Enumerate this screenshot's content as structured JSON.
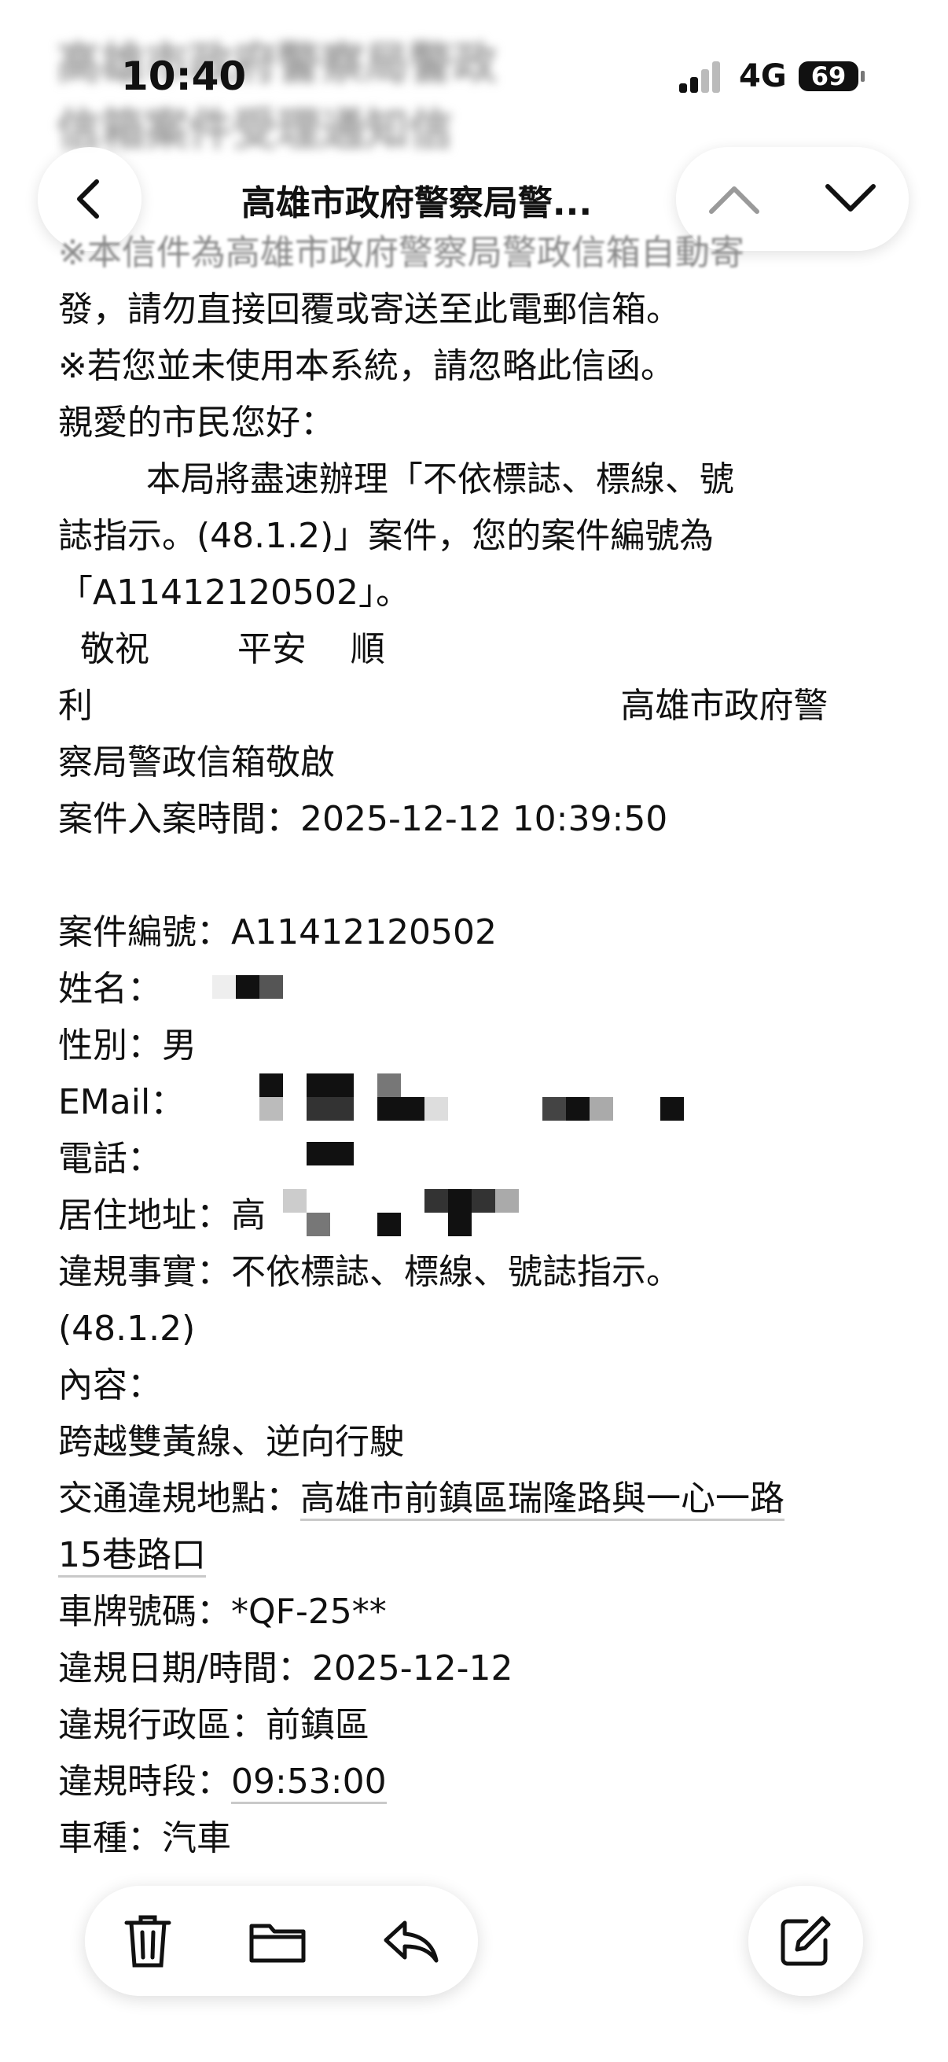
{
  "status_bar": {
    "time": "10:40",
    "network": "4G",
    "battery": "69"
  },
  "header_ghost": [
    "高雄市政府警察局警政",
    "信箱案件受理通知信"
  ],
  "nav": {
    "title": "高雄市政府警察局警..."
  },
  "email": {
    "lines": [
      "※本信件為高雄市政府警察局警政信箱自動寄",
      "發，請勿直接回覆或寄送至此電郵信箱。",
      "※若您並未使用本系統，請忽略此信函。",
      "親愛的市民您好：",
      "        本局將盡速辦理「不依標誌、標線、號",
      "誌指示。(48.1.2)」案件，您的案件編號為",
      "「A11412120502」。",
      "  敬祝        平安    順",
      "利                                                高雄市政府警",
      "察局警政信箱敬啟",
      "案件入案時間：2025-12-12 10:39:50",
      "",
      "案件編號：A11412120502",
      "姓名：",
      "性別：男",
      "EMail：",
      "電話：",
      "居住地址：高",
      "違規事實：不依標誌、標線、號誌指示。",
      "(48.1.2)",
      "內容：",
      "跨越雙黃線、逆向行駛"
    ],
    "location_label": "交通違規地點：",
    "location_value_1": "高雄市前鎮區瑞隆路與一心一路",
    "location_value_2": "15巷路口",
    "plate": "車牌號碼：*QF-25**",
    "date": "違規日期/時間：2025-12-12",
    "district": "違規行政區：前鎮區",
    "period_label": "違規時段：",
    "period_value": "09:53:00",
    "vehicle": "車種：汽車"
  }
}
